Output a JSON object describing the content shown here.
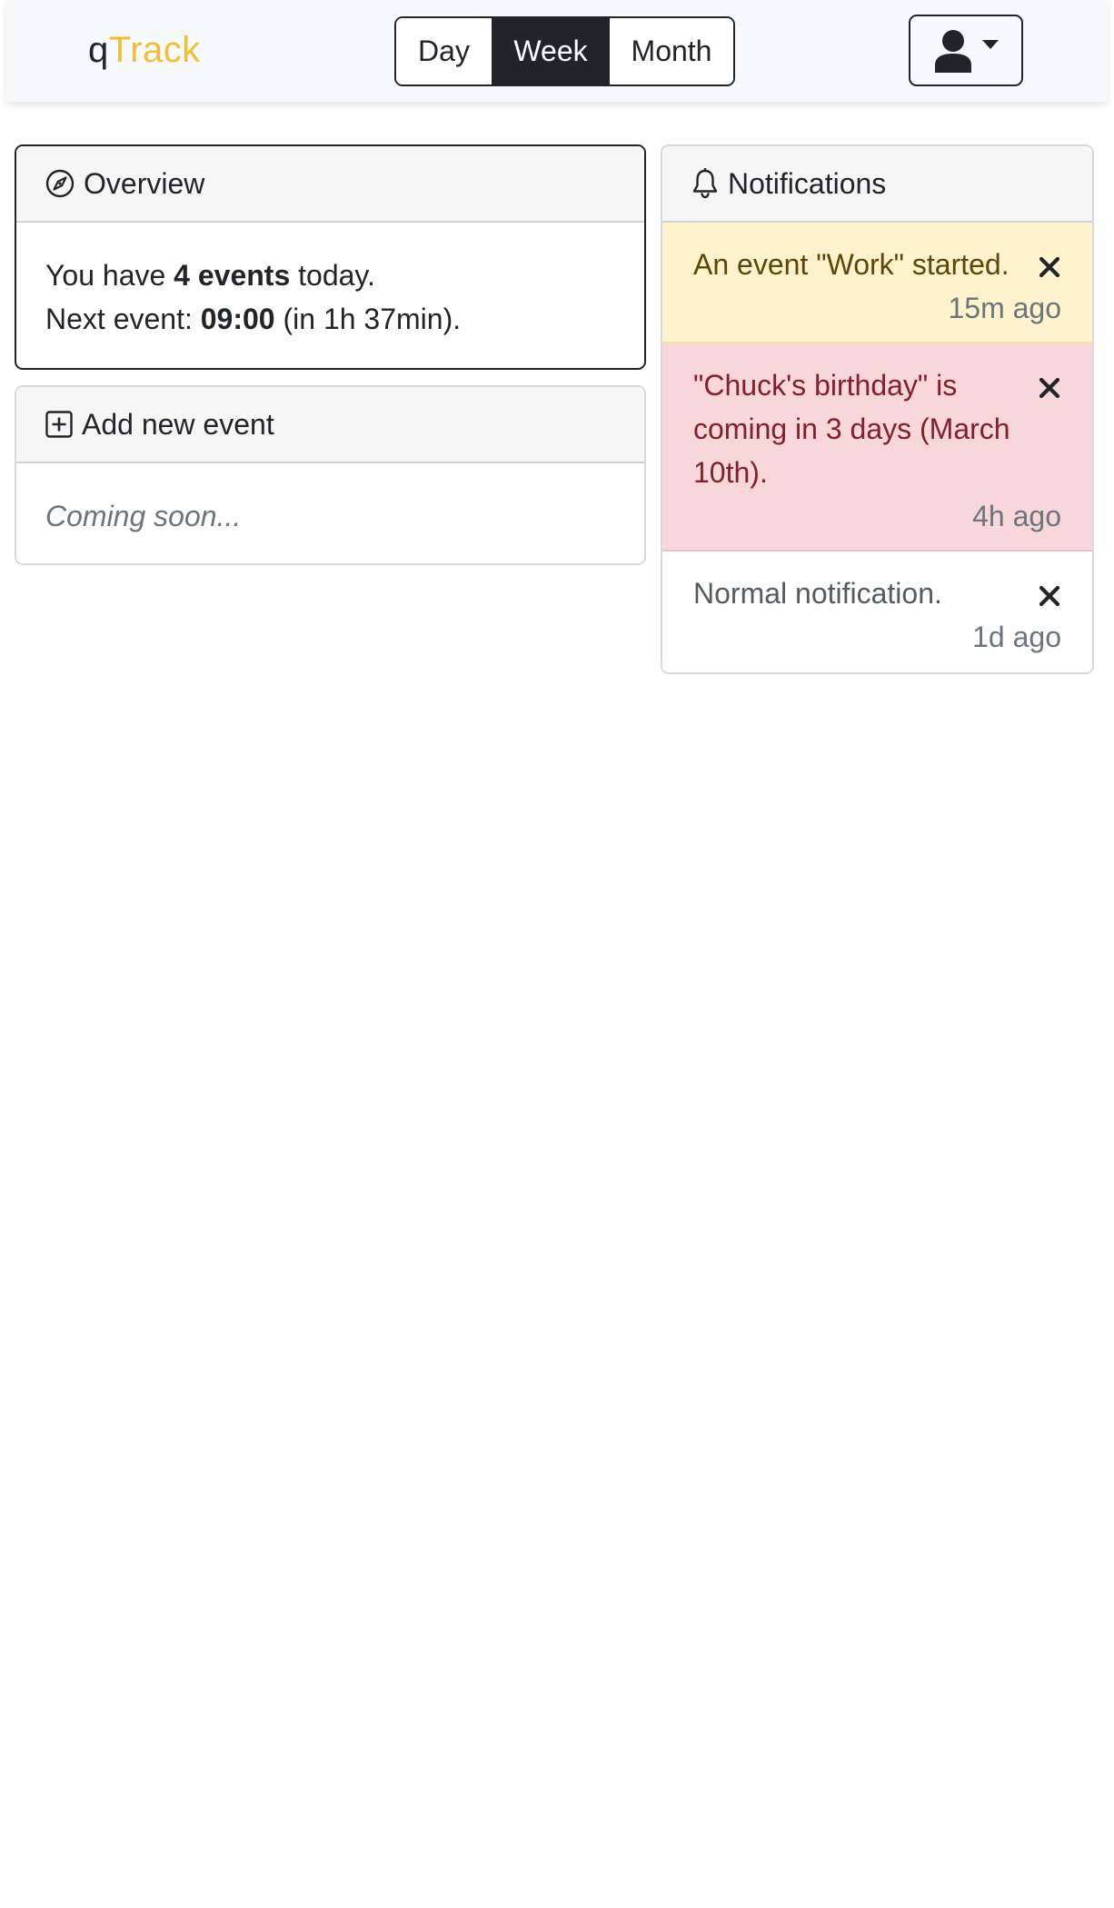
{
  "brand": {
    "prefix": "q",
    "suffix": "Track"
  },
  "colors": {
    "brand_accent": "#f2be3a",
    "warning_bg": "#fff3cd",
    "danger_bg": "#f8d7da",
    "dark": "#212529"
  },
  "view_toggle": {
    "options": [
      "Day",
      "Week",
      "Month"
    ],
    "selected": "Week"
  },
  "user_menu": {
    "icon": "user-icon",
    "caret": "caret-down-icon"
  },
  "overview": {
    "icon": "compass-icon",
    "title": "Overview",
    "line1": {
      "prefix": "You have ",
      "count": "4 events",
      "suffix": " today."
    },
    "line2": {
      "prefix": "Next event: ",
      "time": "09:00",
      "suffix": " (in 1h 37min)."
    }
  },
  "add_event": {
    "icon": "plus-square-icon",
    "title": "Add new event",
    "placeholder": "Coming soon..."
  },
  "notifications": {
    "icon": "bell-icon",
    "title": "Notifications",
    "items": [
      {
        "type": "warning",
        "text": "An event \"Work\" started.",
        "time": "15m ago"
      },
      {
        "type": "danger",
        "text": "\"Chuck's birthday\" is coming in 3 days (March 10th).",
        "time": "4h ago"
      },
      {
        "type": "normal",
        "text": "Normal notification.",
        "time": "1d ago"
      }
    ]
  }
}
